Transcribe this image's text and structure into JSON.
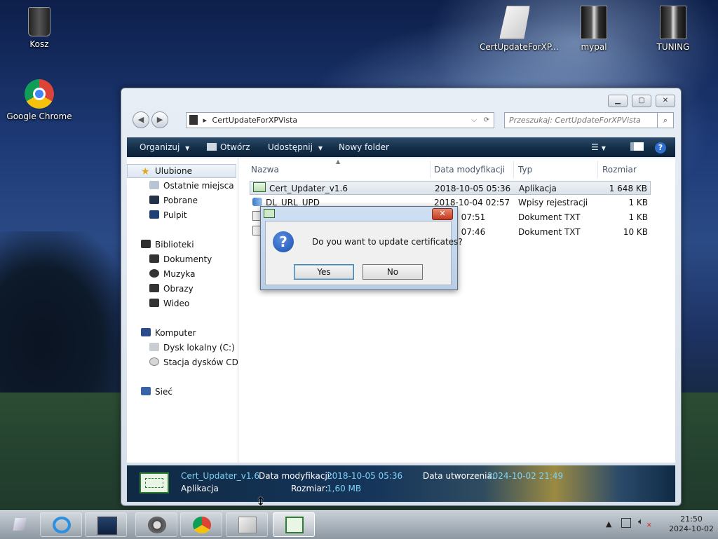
{
  "desktop": {
    "icons": [
      {
        "label": "Kosz"
      },
      {
        "label": "Google Chrome"
      },
      {
        "label": "CertUpdateForXP..."
      },
      {
        "label": "mypal"
      },
      {
        "label": "TUNING"
      }
    ]
  },
  "explorer": {
    "address_folder": "CertUpdateForXPVista",
    "search_placeholder": "Przeszukaj: CertUpdateForXPVista",
    "toolbar": {
      "organize": "Organizuj",
      "open": "Otwórz",
      "share": "Udostępnij",
      "new_folder": "Nowy folder"
    },
    "nav": {
      "favorites": "Ulubione",
      "recent": "Ostatnie miejsca",
      "downloads": "Pobrane",
      "desktop": "Pulpit",
      "libraries": "Biblioteki",
      "documents": "Dokumenty",
      "music": "Muzyka",
      "pictures": "Obrazy",
      "video": "Wideo",
      "computer": "Komputer",
      "disk_c": "Dysk lokalny (C:)",
      "cd_drive": "Stacja dysków CD (D",
      "network": "Sieć"
    },
    "columns": {
      "name": "Nazwa",
      "modified": "Data modyfikacji",
      "type": "Typ",
      "size": "Rozmiar"
    },
    "files": [
      {
        "name": "Cert_Updater_v1.6",
        "modified": "2018-10-05 05:36",
        "type": "Aplikacja",
        "size": "1 648 KB"
      },
      {
        "name": "DL_URL_UPD",
        "modified": "2018-10-04 02:57",
        "type": "Wpisy rejestracji",
        "size": "1 KB"
      },
      {
        "name": "",
        "modified": "10-05 07:51",
        "type": "Dokument TXT",
        "size": "1 KB"
      },
      {
        "name": "",
        "modified": "10-05 07:46",
        "type": "Dokument TXT",
        "size": "10 KB"
      }
    ],
    "details": {
      "name": "Cert_Updater_v1.6",
      "kind": "Aplikacja",
      "modified_label": "Data modyfikacji:",
      "modified_value": "2018-10-05 05:36",
      "created_label": "Data utworzenia:",
      "created_value": "2024-10-02 21:49",
      "size_label": "Rozmiar:",
      "size_value": "1,60 MB"
    }
  },
  "dialog": {
    "message": "Do you want to update certificates?",
    "yes": "Yes",
    "no": "No",
    "close_glyph": "✕"
  },
  "taskbar": {
    "time": "21:50",
    "date": "2024-10-02"
  }
}
